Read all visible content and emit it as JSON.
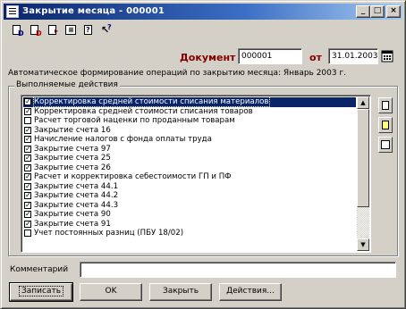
{
  "window": {
    "title": "Закрытие месяца - 000001",
    "controls": [
      "_",
      "□",
      "×"
    ]
  },
  "toolbar": {
    "icons": [
      "doc-d-icon",
      "doc-dt-icon",
      "doc-arrow-icon",
      "list-icon",
      "help-icon",
      "help-pointer-icon"
    ]
  },
  "header": {
    "document_label": "Документ №",
    "document_number": "000001",
    "date_label": "от",
    "date_value": "31.01.2003"
  },
  "description": "Автоматическое формирование операций по закрытию месяца: Январь 2003 г.",
  "actions": {
    "group_title": "Выполняемые действия",
    "items": [
      {
        "label": "Корректировка средней стоимости списания материалов",
        "checked": true,
        "selected": true
      },
      {
        "label": "Корректировка средней стоимости списания товаров",
        "checked": true,
        "selected": false
      },
      {
        "label": "Расчет торговой наценки по проданным товарам",
        "checked": false,
        "selected": false
      },
      {
        "label": "Закрытие счета 16",
        "checked": true,
        "selected": false
      },
      {
        "label": "Начисление налогов с фонда оплаты труда",
        "checked": true,
        "selected": false
      },
      {
        "label": "Закрытие счета 97",
        "checked": true,
        "selected": false
      },
      {
        "label": "Закрытие счета 25",
        "checked": true,
        "selected": false
      },
      {
        "label": "Закрытие счета 26",
        "checked": true,
        "selected": false
      },
      {
        "label": "Расчет и корректировка себестоимости ГП и ПФ",
        "checked": true,
        "selected": false
      },
      {
        "label": "Закрытие счета 44.1",
        "checked": true,
        "selected": false
      },
      {
        "label": "Закрытие счета 44.2",
        "checked": true,
        "selected": false
      },
      {
        "label": "Закрытие счета 44.3",
        "checked": true,
        "selected": false
      },
      {
        "label": "Закрытие счета 90",
        "checked": true,
        "selected": false
      },
      {
        "label": "Закрытие счета 91",
        "checked": true,
        "selected": false
      },
      {
        "label": "Учет постоянных разниц (ПБУ 18/02)",
        "checked": false,
        "selected": false
      }
    ]
  },
  "comment": {
    "label": "Комментарий",
    "value": ""
  },
  "buttons": {
    "record": "Записать",
    "ok": "OK",
    "close": "Закрыть",
    "actions": "Действия..."
  }
}
